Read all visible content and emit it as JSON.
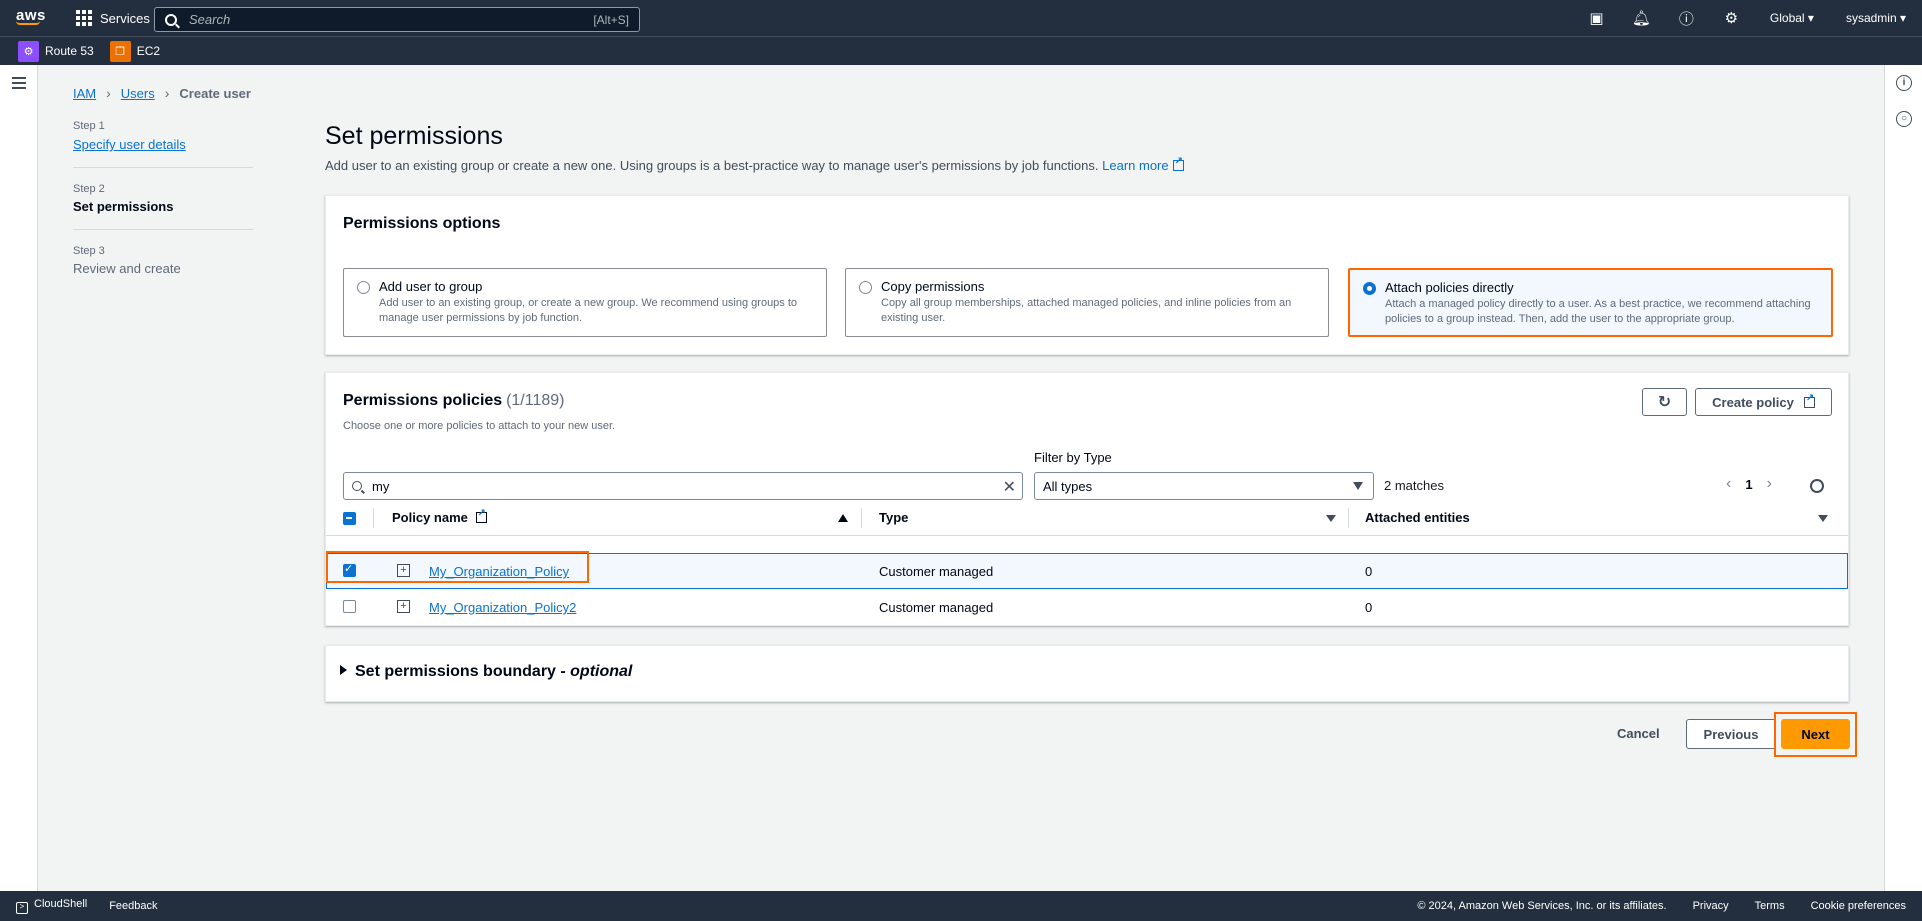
{
  "nav": {
    "logo": "aws",
    "services": "Services",
    "search_placeholder": "Search",
    "search_shortcut": "[Alt+S]",
    "region": "Global",
    "account": "sysadmin"
  },
  "favorites": [
    {
      "label": "Route 53",
      "color": "#8c4fff"
    },
    {
      "label": "EC2",
      "color": "#ed7100"
    }
  ],
  "breadcrumb": {
    "item1": "IAM",
    "item2": "Users",
    "current": "Create user"
  },
  "steps": [
    {
      "num": "Step 1",
      "label": "Specify user details"
    },
    {
      "num": "Step 2",
      "label": "Set permissions"
    },
    {
      "num": "Step 3",
      "label": "Review and create"
    }
  ],
  "page": {
    "title": "Set permissions",
    "desc": "Add user to an existing group or create a new one. Using groups is a best-practice way to manage user's permissions by job functions.",
    "learn_more": "Learn more"
  },
  "options": {
    "title": "Permissions options",
    "items": [
      {
        "title": "Add user to group",
        "desc": "Add user to an existing group, or create a new group. We recommend using groups to manage user permissions by job function."
      },
      {
        "title": "Copy permissions",
        "desc": "Copy all group memberships, attached managed policies, and inline policies from an existing user."
      },
      {
        "title": "Attach policies directly",
        "desc": "Attach a managed policy directly to a user. As a best practice, we recommend attaching policies to a group instead. Then, add the user to the appropriate group."
      }
    ]
  },
  "policies": {
    "title": "Permissions policies",
    "count": "(1/1189)",
    "subtitle": "Choose one or more policies to attach to your new user.",
    "create_policy": "Create policy",
    "search_value": "my",
    "filter_label": "Filter by Type",
    "filter_value": "All types",
    "matches": "2 matches",
    "page": "1",
    "columns": {
      "name": "Policy name",
      "type": "Type",
      "entities": "Attached entities"
    },
    "rows": [
      {
        "name": "My_Organization_Policy",
        "type": "Customer managed",
        "entities": "0"
      },
      {
        "name": "My_Organization_Policy2",
        "type": "Customer managed",
        "entities": "0"
      }
    ]
  },
  "boundary": {
    "title": "Set permissions boundary - ",
    "optional": "optional"
  },
  "actions": {
    "cancel": "Cancel",
    "previous": "Previous",
    "next": "Next"
  },
  "footer": {
    "cloudshell": "CloudShell",
    "feedback": "Feedback",
    "copyright": "© 2024, Amazon Web Services, Inc. or its affiliates.",
    "privacy": "Privacy",
    "terms": "Terms",
    "cookies": "Cookie preferences"
  }
}
